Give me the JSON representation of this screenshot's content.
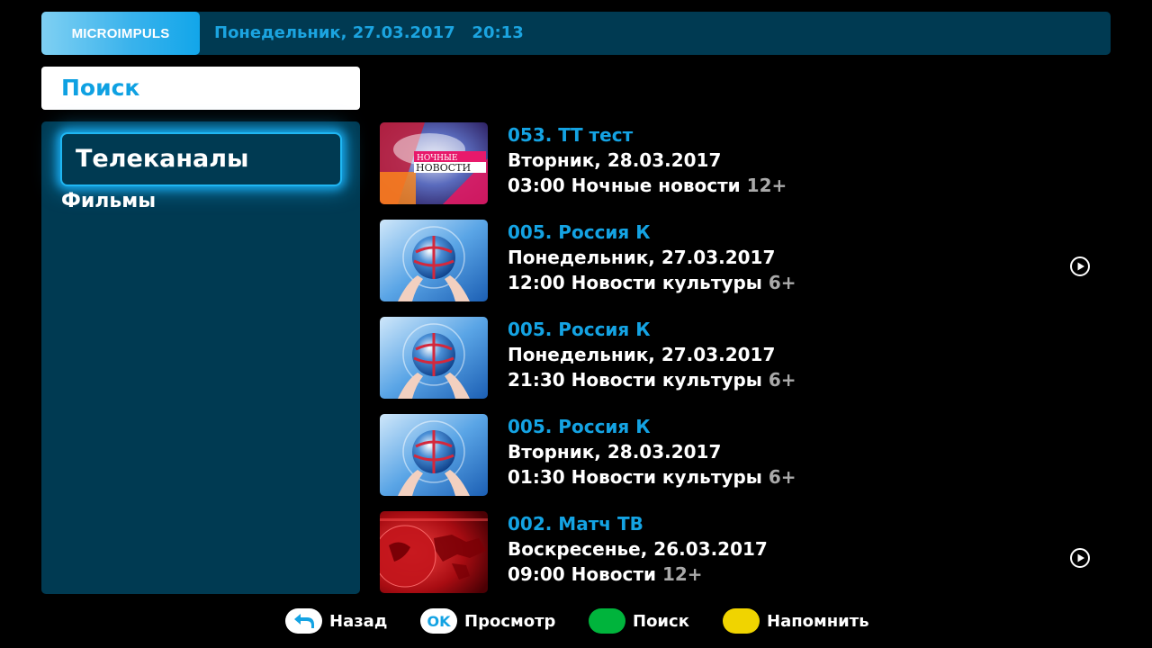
{
  "header": {
    "logo": "MICROIMPULS",
    "datetime": "Понедельник, 27.03.2017   20:13"
  },
  "search_title": "Поиск",
  "categories": [
    {
      "label": "Телеканалы",
      "selected": true
    },
    {
      "label": "Фильмы",
      "selected": false
    }
  ],
  "results": [
    {
      "channel": "053. ТТ тест",
      "date": "Вторник, 28.03.2017",
      "time_title": "03:00 Ночные новости",
      "age": "12+",
      "thumb": "nochnye-novosti",
      "thumb_text_1": "НОЧНЫЕ",
      "thumb_text_2": "НОВОСТИ",
      "recordable": false
    },
    {
      "channel": "005. Россия К",
      "date": "Понедельник, 27.03.2017",
      "time_title": "12:00 Новости культуры",
      "age": "6+",
      "thumb": "globe-hands",
      "recordable": true
    },
    {
      "channel": "005. Россия К",
      "date": "Понедельник, 27.03.2017",
      "time_title": "21:30 Новости культуры",
      "age": "6+",
      "thumb": "globe-hands",
      "recordable": false
    },
    {
      "channel": "005. Россия К",
      "date": "Вторник, 28.03.2017",
      "time_title": "01:30 Новости культуры",
      "age": "6+",
      "thumb": "globe-hands",
      "recordable": false
    },
    {
      "channel": "002. Матч ТВ",
      "date": "Воскресенье, 26.03.2017",
      "time_title": "09:00 Новости",
      "age": "12+",
      "thumb": "red-globe",
      "recordable": true
    }
  ],
  "footer": {
    "back_label": "Назад",
    "ok_key": "OK",
    "view_label": "Просмотр",
    "search_label": "Поиск",
    "remind_label": "Напомнить"
  },
  "colors": {
    "accent": "#14a3e3",
    "panel": "#003a52",
    "green_key": "#00b43c",
    "yellow_key": "#f0d400"
  }
}
